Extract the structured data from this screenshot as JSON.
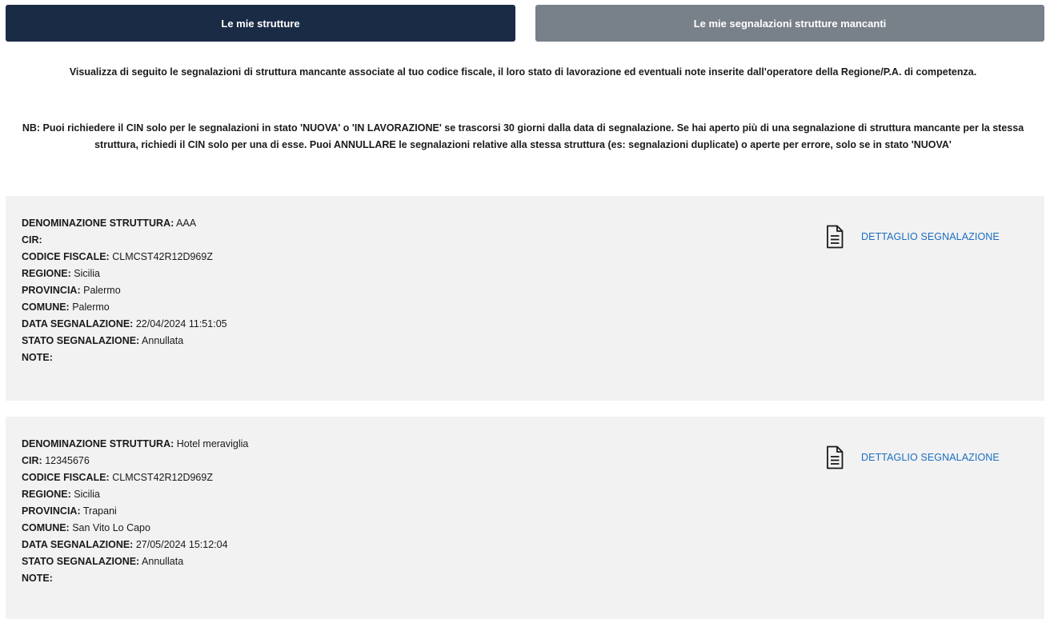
{
  "tabs": {
    "my_structures": "Le mie strutture",
    "my_reports": "Le mie segnalazioni strutture mancanti"
  },
  "intro": "Visualizza di seguito le segnalazioni di struttura mancante associate al tuo codice fiscale, il loro stato di lavorazione ed eventuali note inserite dall'operatore della Regione/P.A. di competenza.",
  "nb": "NB: Puoi richiedere il CIN solo per le segnalazioni in stato 'NUOVA' o 'IN LAVORAZIONE' se trascorsi 30 giorni dalla data di segnalazione. Se hai aperto più di una segnalazione di struttura mancante per la stessa struttura, richiedi il CIN solo per una di esse. Puoi ANNULLARE le segnalazioni relative alla stessa struttura (es: segnalazioni duplicate) o aperte per errore, solo se in stato 'NUOVA'",
  "labels": {
    "denominazione": "DENOMINAZIONE STRUTTURA:",
    "cir": "CIR:",
    "codice_fiscale": "CODICE FISCALE:",
    "regione": "REGIONE:",
    "provincia": "PROVINCIA:",
    "comune": "COMUNE:",
    "data": "DATA SEGNALAZIONE:",
    "stato": "STATO SEGNALAZIONE:",
    "note": "NOTE:",
    "detail_link": "DETTAGLIO SEGNALAZIONE"
  },
  "reports": [
    {
      "denominazione": "AAA",
      "cir": "",
      "codice_fiscale": "CLMCST42R12D969Z",
      "regione": "Sicilia",
      "provincia": "Palermo",
      "comune": "Palermo",
      "data": "22/04/2024 11:51:05",
      "stato": "Annullata",
      "note": ""
    },
    {
      "denominazione": "Hotel meraviglia",
      "cir": "12345676",
      "codice_fiscale": "CLMCST42R12D969Z",
      "regione": "Sicilia",
      "provincia": "Trapani",
      "comune": "San Vito Lo Capo",
      "data": "27/05/2024 15:12:04",
      "stato": "Annullata",
      "note": ""
    }
  ],
  "icons": {
    "detail": "document-icon"
  },
  "colors": {
    "tab_active": "#1a2b45",
    "tab_inactive": "#78808a",
    "link": "#1b6ec2",
    "card_bg": "#f2f2f2"
  }
}
